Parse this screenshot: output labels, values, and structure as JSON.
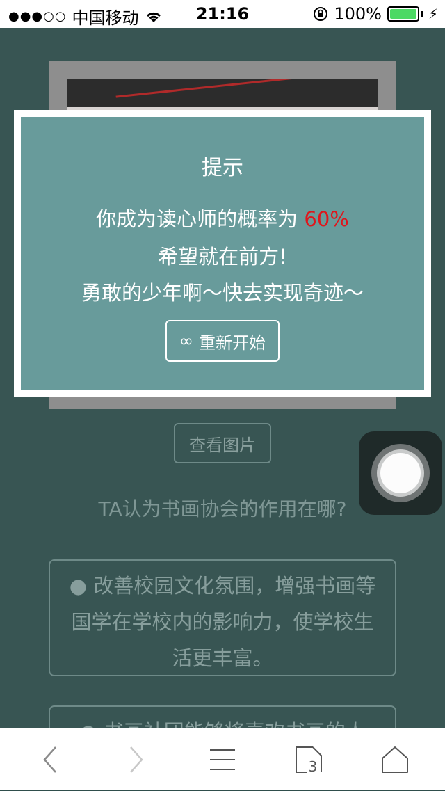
{
  "status_bar": {
    "signal_dots": "●●●○○",
    "carrier": "中国移动",
    "time": "21:16",
    "battery_text": "100%",
    "battery_color": "#4cd964"
  },
  "background": {
    "view_image_button": "查看图片",
    "question": "TA认为书画协会的作用在哪?",
    "answers": [
      "● 改善校园文化氛围，增强书画等国学在学校内的影响力，使学校生活更丰富。",
      "● 书画社团能够将喜欢书画的人"
    ]
  },
  "modal": {
    "title": "提示",
    "line1_prefix": "你成为读心师的概率为",
    "line1_percent": "60%",
    "line2": "希望就在前方!",
    "line3": "勇敢的少年啊～快去实现奇迹～",
    "restart_icon": "∞",
    "restart_label": "重新开始",
    "bg_color": "#689b9b",
    "percent_color": "#e0151b"
  },
  "toolbar": {
    "tabs_count": "3",
    "icons": [
      "back-icon",
      "forward-icon",
      "menu-icon",
      "tabs-icon",
      "home-icon"
    ]
  }
}
